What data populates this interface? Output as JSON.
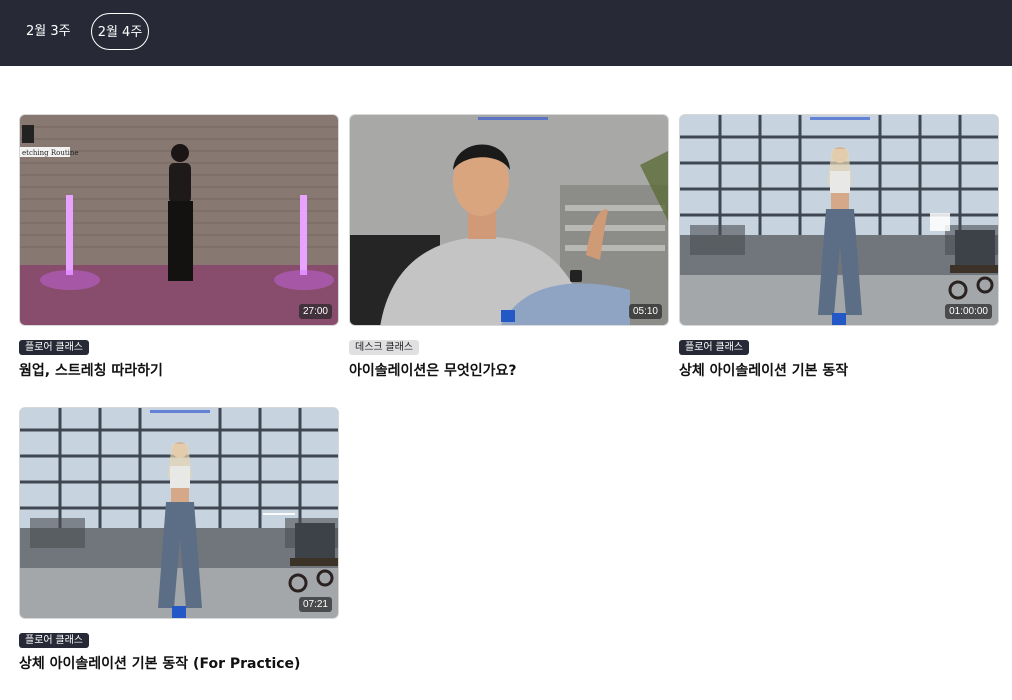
{
  "week_tabs": [
    {
      "label": "2월 3주",
      "selected": false
    },
    {
      "label": "2월 4주",
      "selected": true
    }
  ],
  "videos": [
    {
      "category": "플로어 클래스",
      "title": "웜업, 스트레칭 따라하기",
      "duration": "27:00",
      "thumbnail_caption": "etching Routine"
    },
    {
      "category": "데스크 클래스",
      "title": "아이솔레이션은 무엇인가요?",
      "duration": "05:10"
    },
    {
      "category": "플로어 클래스",
      "title": "상체 아이솔레이션 기본 동작",
      "duration": "01:00:00"
    },
    {
      "category": "플로어 클래스",
      "title": "상체 아이솔레이션 기본 동작 (For Practice)",
      "duration": "07:21"
    }
  ],
  "colors": {
    "header_bg": "#272a36",
    "badge_dark": "#272a36",
    "badge_light": "#e0e0e2"
  }
}
